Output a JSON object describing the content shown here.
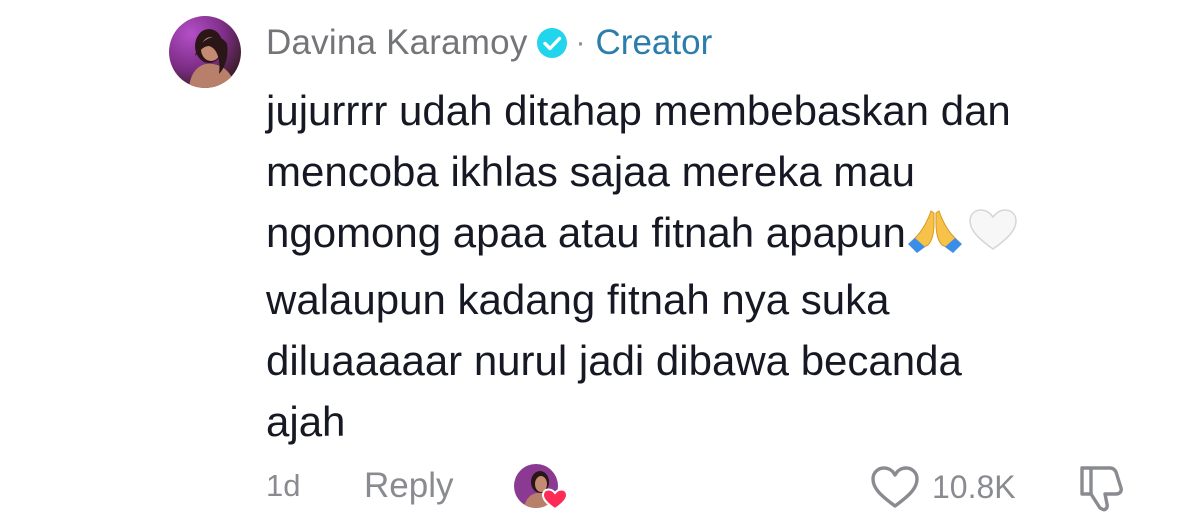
{
  "comment": {
    "author": "Davina Karamoy",
    "verified_icon": "verified-badge-icon",
    "separator": "·",
    "role_badge": "Creator",
    "text": "jujurrrr udah ditahap membebaskan dan\nmencoba ikhlas sajaa mereka mau\nngomong apaa atau fitnah apapun",
    "text_continued": "\nwalaupun kadang fitnah nya suka\ndiluaaaaar nurul jadi dibawa becanda\najah",
    "emojis": [
      "folded-hands-emoji",
      "white-heart-emoji"
    ],
    "time": "1d",
    "reply_label": "Reply",
    "like_count": "10.8K",
    "colors": {
      "username": "#747578",
      "creator": "#2b7dab",
      "verified": "#20d5ec",
      "meta": "#8a8b91",
      "liked_heart": "#fe2c55"
    }
  }
}
